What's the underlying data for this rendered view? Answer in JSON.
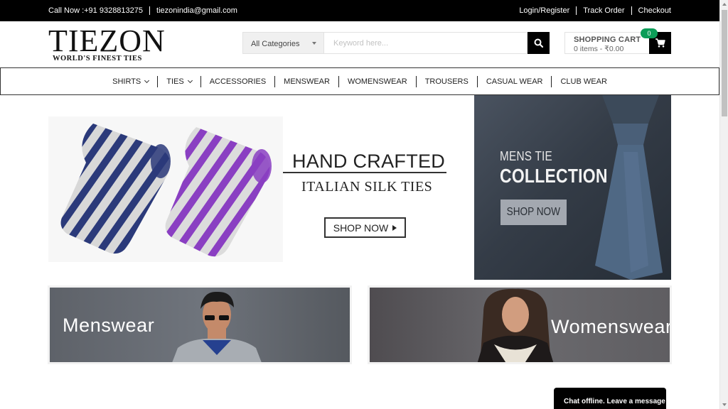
{
  "topbar": {
    "phone": "Call Now :+91 9328813275",
    "email": "tiezonindia@gmail.com",
    "links": [
      "Login/Register",
      "Track Order",
      "Checkout"
    ]
  },
  "logo": {
    "brand": "TIEZON",
    "tagline": "WORLD'S FINEST TIES"
  },
  "search": {
    "category": "All Categories",
    "placeholder": "Keyword here...",
    "button_icon": "search-icon"
  },
  "cart": {
    "title": "SHOPPING CART",
    "summary": "0 items - ₹0.00",
    "count": "0",
    "icon": "cart-icon"
  },
  "nav": {
    "items": [
      {
        "label": "SHIRTS"
      },
      {
        "label": "TIES"
      },
      {
        "label": "ACCESSORIES"
      },
      {
        "label": "MENSWEAR"
      },
      {
        "label": "WOMENSWEAR"
      },
      {
        "label": "TROUSERS"
      },
      {
        "label": "CASUAL WEAR"
      },
      {
        "label": "CLUB WEAR"
      }
    ]
  },
  "hero": {
    "headline": "HAND CRAFTED",
    "subheadline": "ITALIAN SILK TIES",
    "cta": "SHOP NOW",
    "colors": {
      "tie_navy": "#2b3a7a",
      "tie_purple": "#8a3fc2",
      "stripe_light": "#d9d9d9"
    }
  },
  "side_banner": {
    "line1": "MENS TIE",
    "line2": "COLLECTION",
    "cta": "SHOP NOW"
  },
  "tiles": {
    "men": "Menswear",
    "women": "Womenswear"
  },
  "chat": {
    "label": "Chat offline. Leave a message"
  }
}
